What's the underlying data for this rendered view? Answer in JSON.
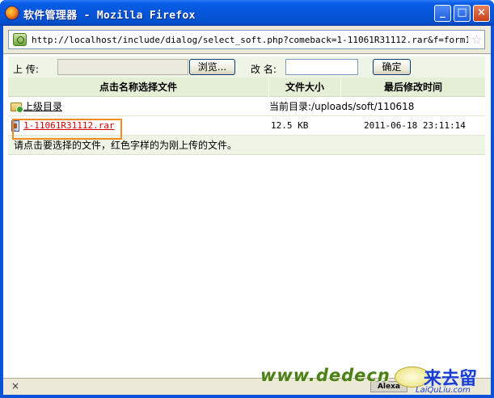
{
  "window": {
    "title": "软件管理器 - Mozilla Firefox",
    "icon": "firefox-icon",
    "controls": [
      "minimize",
      "maximize",
      "close"
    ]
  },
  "address_bar": {
    "url": "http://localhost/include/dialog/select_soft.php?comeback=1-11061R31112.rar&f=form1.softur",
    "site_icon": "site-icon",
    "bookmark_icon": "star-icon"
  },
  "upload": {
    "upload_label": "上  传:",
    "browse_button": "浏览...",
    "rename_label": "改 名:",
    "confirm_button": "确定"
  },
  "table": {
    "headers": {
      "name": "点击名称选择文件",
      "size": "文件大小",
      "modified": "最后修改时间"
    },
    "parent": {
      "label": "上级目录",
      "current_dir": "当前目录:/uploads/soft/110618"
    },
    "files": [
      {
        "name": "1-11061R31112.rar",
        "size": "12.5 KB",
        "modified": "2011-06-18 23:11:14"
      }
    ],
    "notice": "请点击要选择的文件，红色字样的为刚上传的文件。"
  },
  "status_bar": {
    "left": "×",
    "alexa": "Alexa"
  },
  "watermark": {
    "text": "www.dedecn",
    "cn": "来去留",
    "sub": "LaiQuLiu.com"
  },
  "colors": {
    "titlebar": "#0655d9",
    "header_bg": "#e4efd5",
    "new_file_red": "#d40000",
    "highlight_orange": "#f08c20"
  }
}
